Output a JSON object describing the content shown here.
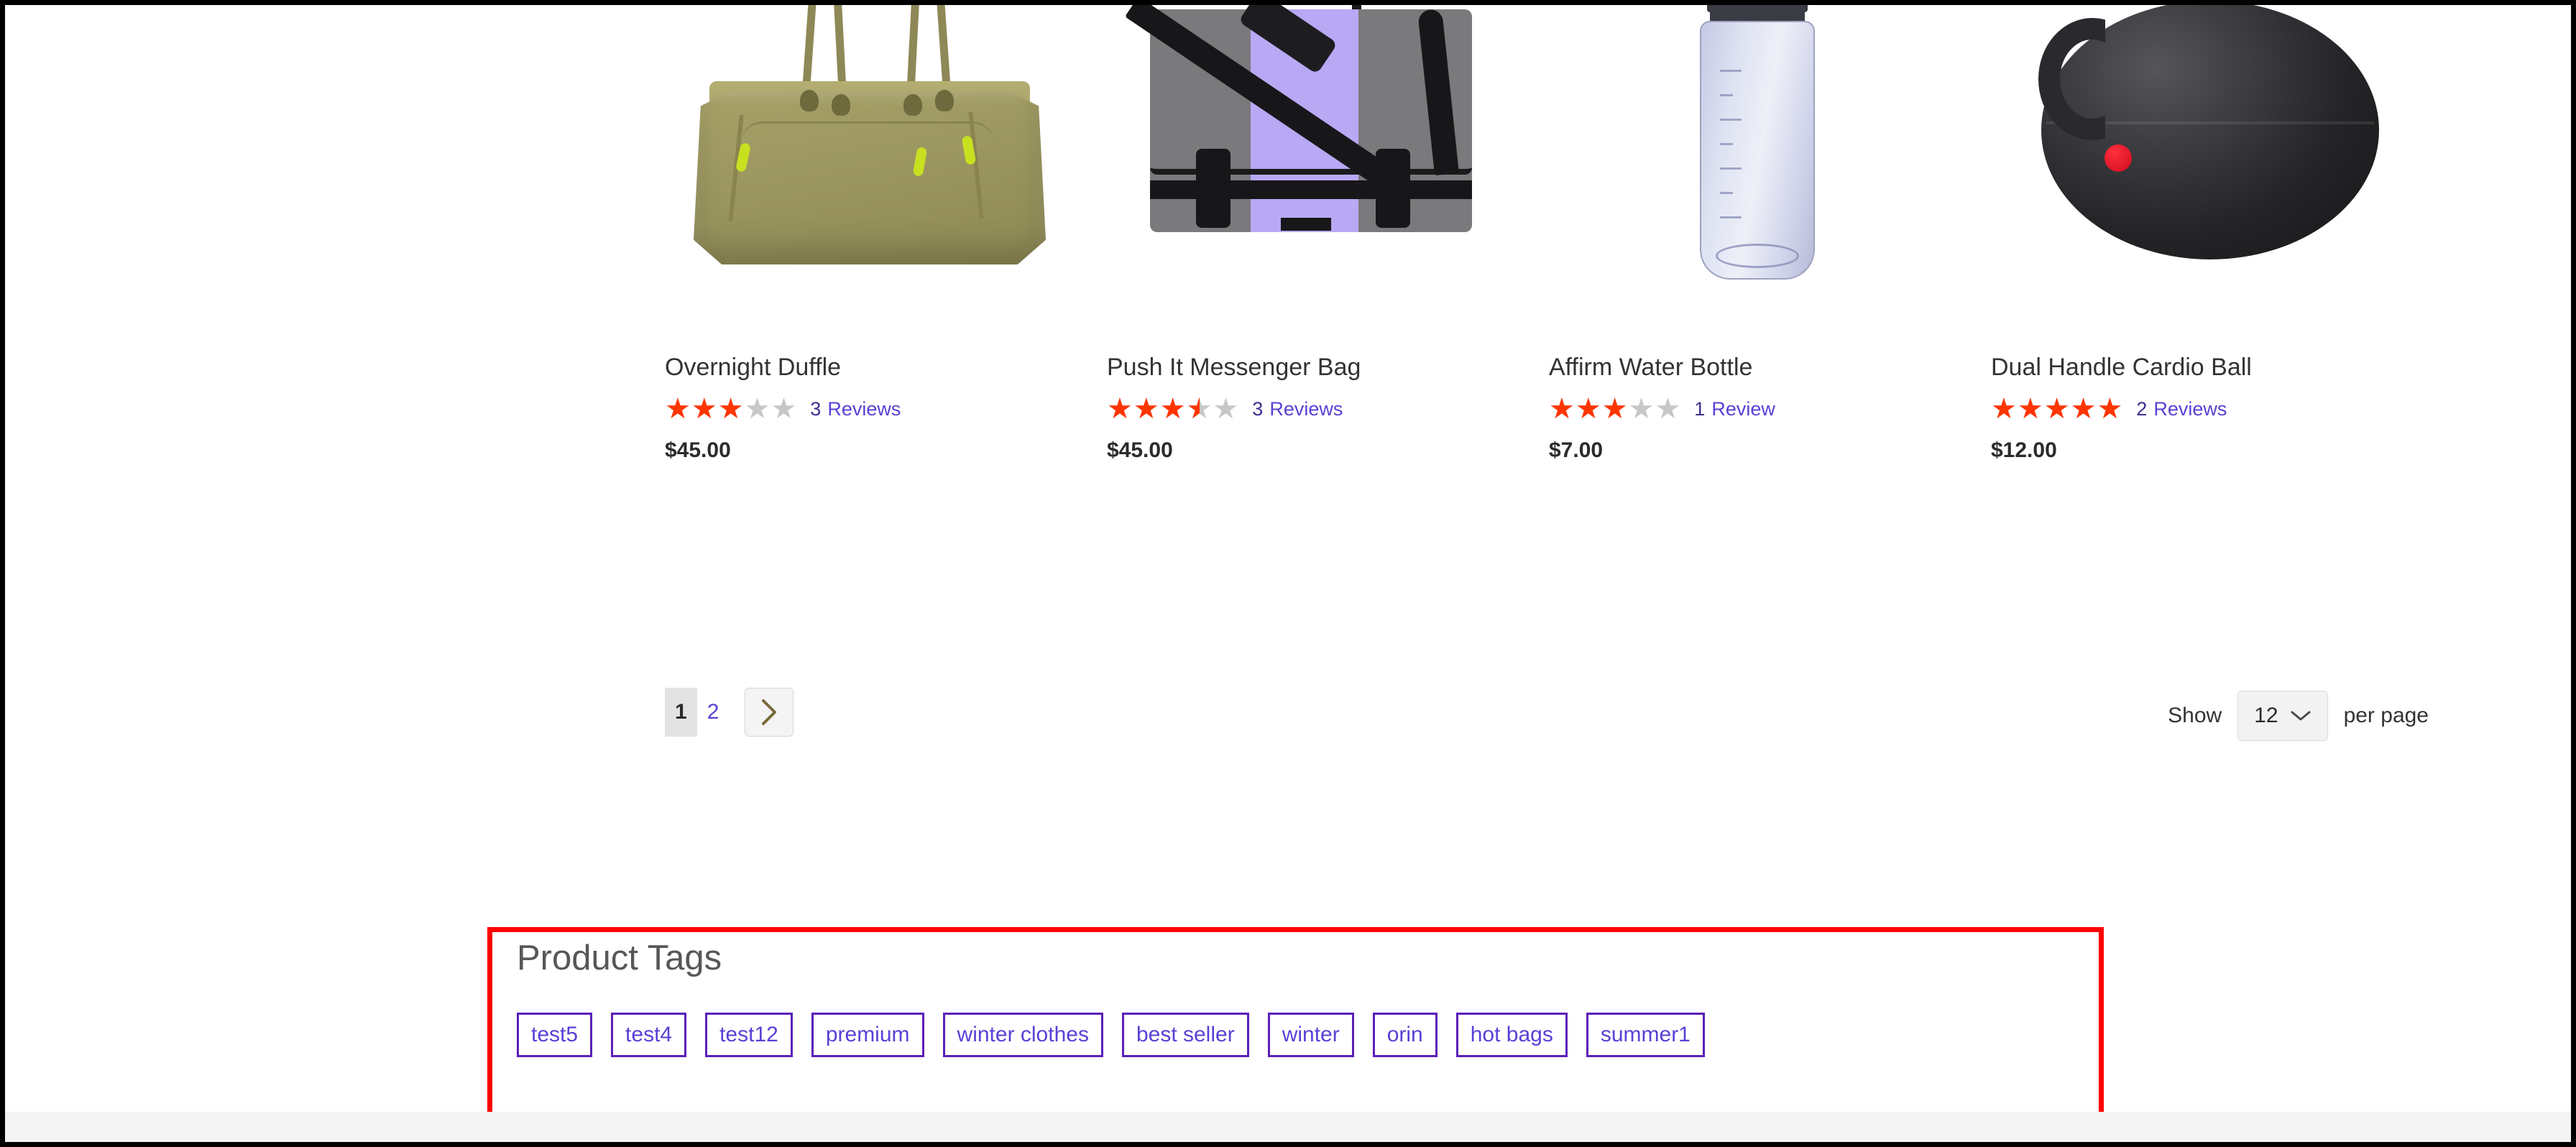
{
  "products": [
    {
      "name": "Overnight Duffle",
      "rating_percent": 60,
      "review_count": "3",
      "review_word": "Reviews",
      "price": "$45.00",
      "image": "olive-duffle-bag-image"
    },
    {
      "name": "Push It Messenger Bag",
      "rating_percent": 70,
      "review_count": "3",
      "review_word": "Reviews",
      "price": "$45.00",
      "image": "gray-purple-messenger-bag-image"
    },
    {
      "name": "Affirm Water Bottle",
      "rating_percent": 60,
      "review_count": "1",
      "review_word": "Review",
      "price": "$7.00",
      "image": "clear-water-bottle-image"
    },
    {
      "name": "Dual Handle Cardio Ball",
      "rating_percent": 100,
      "review_count": "2",
      "review_word": "Reviews",
      "price": "$12.00",
      "image": "black-cardio-ball-image"
    }
  ],
  "toolbar": {
    "pages": [
      {
        "label": "1",
        "current": true
      },
      {
        "label": "2",
        "current": false
      }
    ],
    "next_label": "Next",
    "show_label": "Show",
    "per_page_label": "per page",
    "limit_value": "12"
  },
  "product_tags": {
    "title": "Product Tags",
    "tags": [
      "test5",
      "test4",
      "test12",
      "premium",
      "winter clothes",
      "best seller",
      "winter",
      "orin",
      "hot bags",
      "summer1"
    ]
  },
  "colors": {
    "star_filled": "#ff3500",
    "star_empty": "#c7c7c7",
    "link": "#5b3fd6",
    "tag_border": "#5b1fb8",
    "highlight": "#ff0000",
    "text": "#333333"
  }
}
